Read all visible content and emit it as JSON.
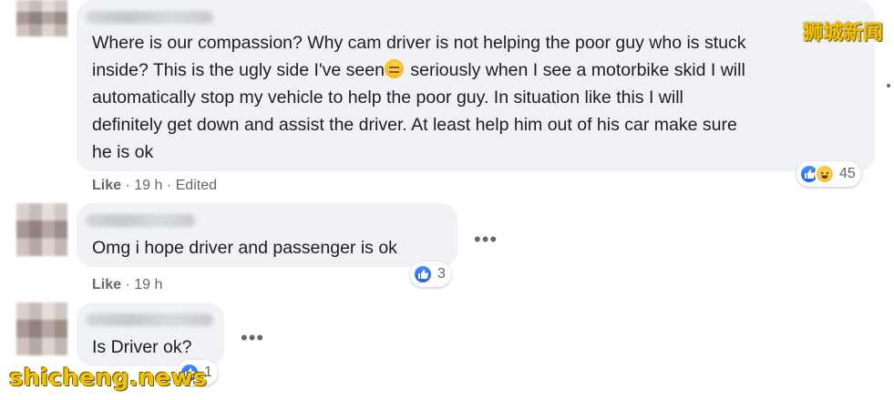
{
  "comments": [
    {
      "text_lines": [
        "Where is our compassion? Why cam driver is not helping the poor guy who is stuck",
        "inside? This is the ugly side I've seen",
        " seriously when I see a motorbike skid I will",
        "automatically stop my vehicle to help the poor guy. In situation like this I will",
        "definitely get down and assist the driver. At least help him out of his car make sure",
        "he is ok"
      ],
      "like_label": "Like",
      "time": "19 h",
      "edited": "Edited",
      "reaction_icons": [
        "like-icon",
        "haha-icon"
      ],
      "reaction_count": "45"
    },
    {
      "text": "Omg i hope driver and passenger is ok",
      "like_label": "Like",
      "time": "19 h",
      "reaction_icons": [
        "like-icon"
      ],
      "reaction_count": "3",
      "more_label": "•••"
    },
    {
      "text": "Is Driver ok?",
      "reaction_icons": [
        "like-icon"
      ],
      "reaction_count": "1",
      "more_label": "•••"
    }
  ],
  "watermarks": {
    "top_right": "狮城新闻",
    "bottom_left": "shicheng.news"
  },
  "colors": {
    "bubble": "#f0f2f5",
    "meta_text": "#65676b",
    "like_blue": "#1877f2",
    "watermark": "#f2c200"
  }
}
